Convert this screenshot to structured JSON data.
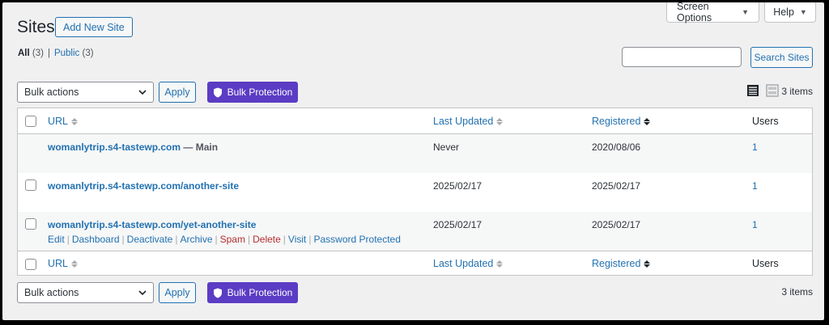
{
  "screen_meta": {
    "screen_options": "Screen Options",
    "help": "Help"
  },
  "header": {
    "title": "Sites",
    "add_new": "Add New Site"
  },
  "filters": {
    "all_label": "All",
    "all_count": "(3)",
    "separator": "|",
    "public_label": "Public",
    "public_count": "(3)"
  },
  "search": {
    "value": "",
    "button": "Search Sites"
  },
  "tablenav_top": {
    "bulk_select": "Bulk actions",
    "apply": "Apply",
    "bulk_protection": "Bulk Protection",
    "items": "3 items"
  },
  "tablenav_bottom": {
    "bulk_select": "Bulk actions",
    "apply": "Apply",
    "bulk_protection": "Bulk Protection",
    "items": "3 items"
  },
  "columns": {
    "url": "URL",
    "last_updated": "Last Updated",
    "registered": "Registered",
    "users": "Users"
  },
  "rows": [
    {
      "url": "womanlytrip.s4-tastewp.com",
      "suffix": " — Main",
      "last_updated": "Never",
      "registered": "2020/08/06",
      "users": "1"
    },
    {
      "url": "womanlytrip.s4-tastewp.com/another-site",
      "last_updated": "2025/02/17",
      "registered": "2025/02/17",
      "users": "1"
    },
    {
      "url": "womanlytrip.s4-tastewp.com/yet-another-site",
      "last_updated": "2025/02/17",
      "registered": "2025/02/17",
      "users": "1",
      "actions": {
        "edit": "Edit",
        "dashboard": "Dashboard",
        "deactivate": "Deactivate",
        "archive": "Archive",
        "spam": "Spam",
        "delete": "Delete",
        "visit": "Visit",
        "password_protected": "Password Protected",
        "sep": "|"
      }
    }
  ],
  "colors": {
    "accent": "#2271b1",
    "protection": "#5b3cc4",
    "danger": "#b32d2e"
  },
  "icons": {
    "caret": "caret-down-icon",
    "shield": "shield-icon",
    "list_view": "list-view-icon",
    "excerpt_view": "excerpt-view-icon",
    "sort": "sort-arrows-icon"
  }
}
